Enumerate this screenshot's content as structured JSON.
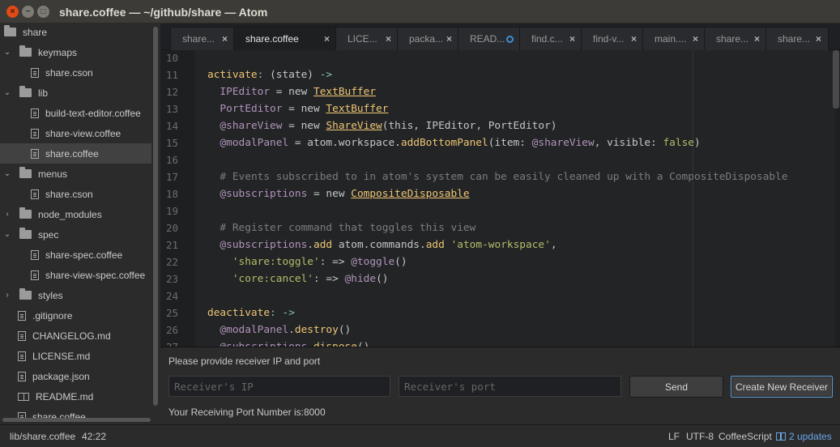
{
  "window": {
    "title": "share.coffee — ~/github/share — Atom",
    "close_glyph": "×",
    "min_glyph": "−",
    "max_glyph": "□"
  },
  "tree": {
    "items": [
      {
        "label": "share",
        "kind": "folder",
        "depth": 0,
        "expanded": null
      },
      {
        "label": "keymaps",
        "kind": "folder",
        "depth": 1,
        "expanded": true
      },
      {
        "label": "share.cson",
        "kind": "file",
        "depth": 2
      },
      {
        "label": "lib",
        "kind": "folder",
        "depth": 1,
        "expanded": true
      },
      {
        "label": "build-text-editor.coffee",
        "kind": "file",
        "depth": 2
      },
      {
        "label": "share-view.coffee",
        "kind": "file",
        "depth": 2
      },
      {
        "label": "share.coffee",
        "kind": "file",
        "depth": 2,
        "selected": true
      },
      {
        "label": "menus",
        "kind": "folder",
        "depth": 1,
        "expanded": true
      },
      {
        "label": "share.cson",
        "kind": "file",
        "depth": 2
      },
      {
        "label": "node_modules",
        "kind": "folder",
        "depth": 1,
        "expanded": false
      },
      {
        "label": "spec",
        "kind": "folder",
        "depth": 1,
        "expanded": true
      },
      {
        "label": "share-spec.coffee",
        "kind": "file",
        "depth": 2
      },
      {
        "label": "share-view-spec.coffee",
        "kind": "file",
        "depth": 2
      },
      {
        "label": "styles",
        "kind": "folder",
        "depth": 1,
        "expanded": false
      },
      {
        "label": ".gitignore",
        "kind": "file",
        "depth": 1
      },
      {
        "label": "CHANGELOG.md",
        "kind": "file",
        "depth": 1
      },
      {
        "label": "LICENSE.md",
        "kind": "file",
        "depth": 1
      },
      {
        "label": "package.json",
        "kind": "file",
        "depth": 1
      },
      {
        "label": "README.md",
        "kind": "book",
        "depth": 1
      },
      {
        "label": "share.coffee",
        "kind": "file",
        "depth": 1
      }
    ],
    "expanded_glyph": "⌄",
    "collapsed_glyph": "›"
  },
  "tabs": [
    {
      "label": "share...",
      "active": false,
      "modified": false
    },
    {
      "label": "share.coffee",
      "active": true,
      "modified": false
    },
    {
      "label": "LICE...",
      "active": false,
      "modified": false
    },
    {
      "label": "packa...",
      "active": false,
      "modified": false
    },
    {
      "label": "READ...",
      "active": false,
      "modified": true
    },
    {
      "label": "find.c...",
      "active": false,
      "modified": false
    },
    {
      "label": "find-v...",
      "active": false,
      "modified": false
    },
    {
      "label": "main....",
      "active": false,
      "modified": false
    },
    {
      "label": "share...",
      "active": false,
      "modified": false
    },
    {
      "label": "share...",
      "active": false,
      "modified": false
    }
  ],
  "tab_close_glyph": "×",
  "editor": {
    "lines": [
      {
        "n": "10",
        "tokens": []
      },
      {
        "n": "11",
        "tokens": [
          [
            "f",
            "activate"
          ],
          [
            "o",
            ":"
          ],
          [
            "n",
            " (state) "
          ],
          [
            "o",
            "->"
          ]
        ]
      },
      {
        "n": "12",
        "tokens": [
          [
            "n",
            "  "
          ],
          [
            "v",
            "IPEditor"
          ],
          [
            "n",
            " = new "
          ],
          [
            "t",
            "TextBuffer"
          ]
        ]
      },
      {
        "n": "13",
        "tokens": [
          [
            "n",
            "  "
          ],
          [
            "v",
            "PortEditor"
          ],
          [
            "n",
            " = new "
          ],
          [
            "t",
            "TextBuffer"
          ]
        ]
      },
      {
        "n": "14",
        "tokens": [
          [
            "n",
            "  "
          ],
          [
            "v",
            "@shareView"
          ],
          [
            "n",
            " = new "
          ],
          [
            "t",
            "ShareView"
          ],
          [
            "n",
            "(this, IPEditor, PortEditor)"
          ]
        ]
      },
      {
        "n": "15",
        "tokens": [
          [
            "n",
            "  "
          ],
          [
            "v",
            "@modalPanel"
          ],
          [
            "n",
            " = atom.workspace."
          ],
          [
            "f",
            "addBottomPanel"
          ],
          [
            "n",
            "(item: "
          ],
          [
            "v",
            "@shareView"
          ],
          [
            "n",
            ", visible: "
          ],
          [
            "s",
            "false"
          ],
          [
            "n",
            ")"
          ]
        ]
      },
      {
        "n": "16",
        "tokens": []
      },
      {
        "n": "17",
        "tokens": [
          [
            "n",
            "  "
          ],
          [
            "c",
            "# Events subscribed to in atom's system can be easily cleaned up with a CompositeDisposable"
          ]
        ]
      },
      {
        "n": "18",
        "tokens": [
          [
            "n",
            "  "
          ],
          [
            "v",
            "@subscriptions"
          ],
          [
            "n",
            " = new "
          ],
          [
            "t",
            "CompositeDisposable"
          ]
        ]
      },
      {
        "n": "19",
        "tokens": []
      },
      {
        "n": "20",
        "tokens": [
          [
            "n",
            "  "
          ],
          [
            "c",
            "# Register command that toggles this view"
          ]
        ]
      },
      {
        "n": "21",
        "tokens": [
          [
            "n",
            "  "
          ],
          [
            "v",
            "@subscriptions"
          ],
          [
            "n",
            "."
          ],
          [
            "f",
            "add"
          ],
          [
            "n",
            " atom.commands."
          ],
          [
            "f",
            "add"
          ],
          [
            "n",
            " "
          ],
          [
            "s",
            "'atom-workspace'"
          ],
          [
            "n",
            ","
          ]
        ]
      },
      {
        "n": "22",
        "tokens": [
          [
            "n",
            "    "
          ],
          [
            "s",
            "'share:toggle'"
          ],
          [
            "n",
            ": => "
          ],
          [
            "v",
            "@toggle"
          ],
          [
            "n",
            "()"
          ]
        ]
      },
      {
        "n": "23",
        "tokens": [
          [
            "n",
            "    "
          ],
          [
            "s",
            "'core:cancel'"
          ],
          [
            "n",
            ": => "
          ],
          [
            "v",
            "@hide"
          ],
          [
            "n",
            "()"
          ]
        ]
      },
      {
        "n": "24",
        "tokens": []
      },
      {
        "n": "25",
        "tokens": [
          [
            "f",
            "deactivate"
          ],
          [
            "o",
            ":"
          ],
          [
            "n",
            " "
          ],
          [
            "o",
            "->"
          ]
        ]
      },
      {
        "n": "26",
        "tokens": [
          [
            "n",
            "  "
          ],
          [
            "v",
            "@modalPanel"
          ],
          [
            "n",
            "."
          ],
          [
            "f",
            "destroy"
          ],
          [
            "n",
            "()"
          ]
        ]
      },
      {
        "n": "27",
        "tokens": [
          [
            "n",
            "  "
          ],
          [
            "v",
            "@subscriptions"
          ],
          [
            "n",
            "."
          ],
          [
            "f",
            "dispose"
          ],
          [
            "n",
            "()"
          ]
        ]
      }
    ]
  },
  "panel": {
    "prompt": "Please provide receiver IP and port",
    "ip_placeholder": "Receiver's IP",
    "port_placeholder": "Receiver's port",
    "send_label": "Send",
    "create_label": "Create New Receiver",
    "port_status": "Your Receiving Port Number is:8000"
  },
  "status": {
    "path": "lib/share.coffee",
    "cursor": "42:22",
    "line_ending": "LF",
    "encoding": "UTF-8",
    "grammar": "CoffeeScript",
    "updates": "2 updates"
  },
  "colors": {
    "accent": "#5b9bd5",
    "close_button": "#df4a16",
    "keyword_yellow": "#f0c674",
    "variable_purple": "#b294bb",
    "string_green": "#b5bd68",
    "comment_gray": "#7b7e80"
  }
}
